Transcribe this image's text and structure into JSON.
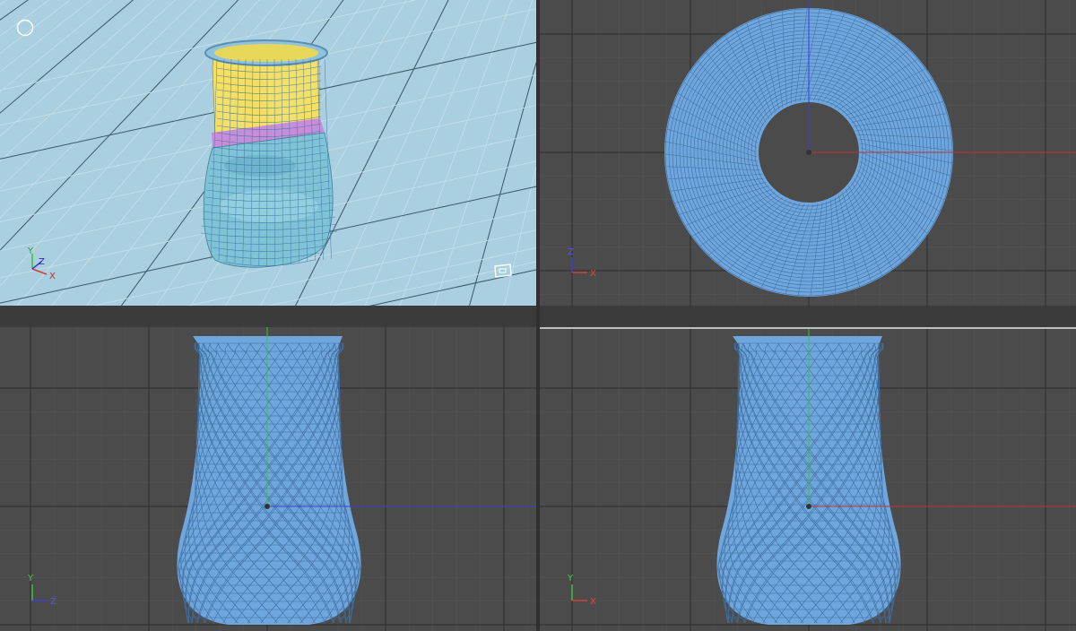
{
  "viewports": {
    "perspective": {
      "axes": {
        "y": "Y",
        "z": "Z",
        "x": "X"
      }
    },
    "top": {
      "axes": {
        "y": "Z",
        "x": "X"
      }
    },
    "side": {
      "axes": {
        "y": "Y",
        "x": "Z"
      }
    },
    "front": {
      "axes": {
        "y": "Y",
        "x": "X"
      }
    }
  },
  "colors": {
    "wire": "#6fa6de",
    "wire_line": "#3f6e9e",
    "grid_dark": "#575757",
    "grid_major": "#2e2e2e",
    "persp_bg": "#a9cfe0",
    "axis_x": "#d23c3c",
    "axis_y": "#3cbf3c",
    "axis_z": "#3c3cd2"
  },
  "icons": [
    "menu-circle-icon",
    "camera-frame-icon"
  ]
}
